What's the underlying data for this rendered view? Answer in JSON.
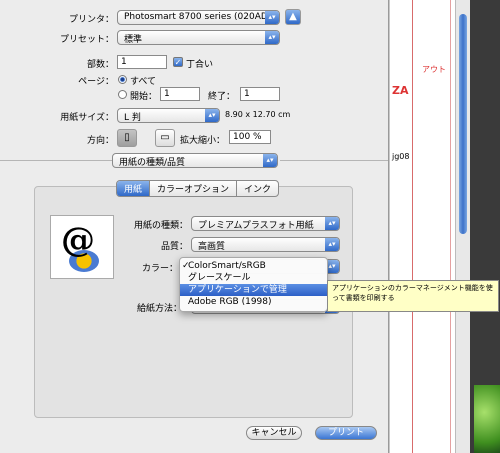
{
  "printer": {
    "label": "プリンタ：",
    "value": "Photosmart 8700 series (020AD0)"
  },
  "preset": {
    "label": "プリセット：",
    "value": "標準"
  },
  "copies": {
    "label": "部数：",
    "value": "1",
    "collate_label": "丁合い",
    "collate_checked": true
  },
  "pages": {
    "label": "ページ：",
    "all_label": "すべて",
    "from_label": "開始：",
    "from_value": "1",
    "to_label": "終了：",
    "to_value": "1"
  },
  "paper_size": {
    "label": "用紙サイズ：",
    "value": "L 判",
    "dims": "8.90 x 12.70 cm"
  },
  "orientation": {
    "label": "方向：",
    "scale_label": "拡大縮小：",
    "scale_value": "100 %"
  },
  "section_select": "用紙の種類/品質",
  "tabs": [
    "用紙",
    "カラーオプション",
    "インク"
  ],
  "paper_type": {
    "label": "用紙の種類：",
    "value": "プレミアムプラスフォト用紙"
  },
  "quality": {
    "label": "品質：",
    "value": "高画質"
  },
  "color": {
    "label": "カラー："
  },
  "feed": {
    "label": "給紙方法："
  },
  "color_menu": [
    {
      "label": "ColorSmart/sRGB",
      "checked": true
    },
    {
      "label": "グレースケール",
      "checked": false
    },
    {
      "label": "アプリケーションで管理",
      "highlighted": true
    },
    {
      "label": "Adobe RGB (1998)",
      "checked": false
    }
  ],
  "tooltip": "アプリケーションのカラーマネージメント機能を使って書類を印刷する",
  "buttons": {
    "cancel": "キャンセル",
    "print": "プリント"
  },
  "background": {
    "frag1": "アウト",
    "frag2": "ZA",
    "frag3": "jg08"
  }
}
